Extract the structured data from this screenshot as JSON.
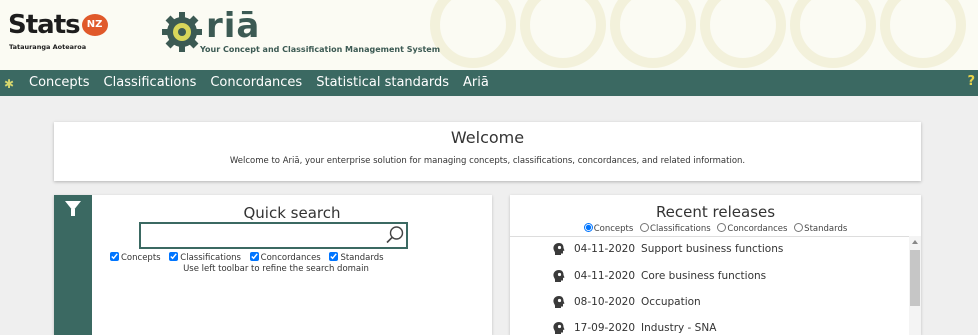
{
  "header": {
    "stats_logo": "Stats",
    "stats_badge": "NZ",
    "stats_subtitle": "Tatauranga Aotearoa",
    "aria_logo": "riā",
    "aria_tagline": "Your Concept and Classification Management System"
  },
  "nav": {
    "items": [
      "Concepts",
      "Classifications",
      "Concordances",
      "Statistical standards",
      "Ariā"
    ],
    "help_label": "?"
  },
  "welcome": {
    "title": "Welcome",
    "text": "Welcome to Ariā, your enterprise solution for managing concepts, classifications, concordances, and related information."
  },
  "quick_search": {
    "title": "Quick search",
    "query": "",
    "checkboxes": [
      {
        "label": "Concepts",
        "checked": true
      },
      {
        "label": "Classifications",
        "checked": true
      },
      {
        "label": "Concordances",
        "checked": true
      },
      {
        "label": "Standards",
        "checked": true
      }
    ],
    "hint": "Use left toolbar to refine the search domain"
  },
  "recent_releases": {
    "title": "Recent releases",
    "radios": [
      {
        "label": "Concepts",
        "selected": true
      },
      {
        "label": "Classifications",
        "selected": false
      },
      {
        "label": "Concordances",
        "selected": false
      },
      {
        "label": "Standards",
        "selected": false
      }
    ],
    "items": [
      {
        "date": "04-11-2020",
        "name": "Support business functions"
      },
      {
        "date": "04-11-2020",
        "name": "Core business functions"
      },
      {
        "date": "08-10-2020",
        "name": "Occupation"
      },
      {
        "date": "17-09-2020",
        "name": "Industry - SNA"
      }
    ]
  },
  "colors": {
    "brand_teal": "#3b6962",
    "stats_orange": "#e0592a",
    "help_yellow": "#e8d34a"
  },
  "icons": {
    "filter": "funnel-icon",
    "search": "magnifier-icon",
    "release": "lightbulb-head-icon"
  }
}
